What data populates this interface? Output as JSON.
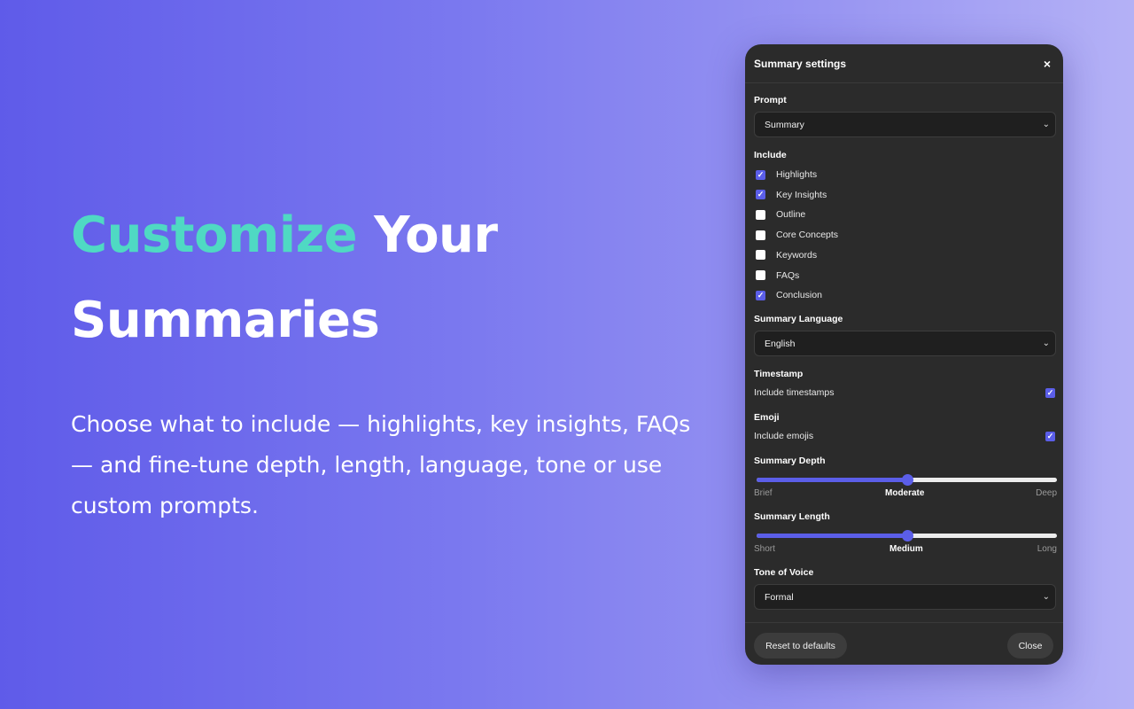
{
  "hero": {
    "title_accent": "Customize",
    "title_rest": "Your",
    "title_line2": "Summaries",
    "description": "Choose what to include — highlights, key insights, FAQs — and fine-tune depth, length, language, tone or use custom prompts."
  },
  "panel": {
    "title": "Summary settings",
    "close_icon": "×",
    "prompt": {
      "label": "Prompt",
      "value": "Summary"
    },
    "include": {
      "label": "Include",
      "items": [
        {
          "label": "Highlights",
          "checked": true
        },
        {
          "label": "Key Insights",
          "checked": true
        },
        {
          "label": "Outline",
          "checked": false
        },
        {
          "label": "Core Concepts",
          "checked": false
        },
        {
          "label": "Keywords",
          "checked": false
        },
        {
          "label": "FAQs",
          "checked": false
        },
        {
          "label": "Conclusion",
          "checked": true
        }
      ]
    },
    "language": {
      "label": "Summary Language",
      "value": "English"
    },
    "timestamp": {
      "label": "Timestamp",
      "option": "Include timestamps",
      "checked": true
    },
    "emoji": {
      "label": "Emoji",
      "option": "Include emojis",
      "checked": true
    },
    "depth": {
      "label": "Summary Depth",
      "min_label": "Brief",
      "mid_label": "Moderate",
      "max_label": "Deep",
      "value": 0.5
    },
    "length": {
      "label": "Summary Length",
      "min_label": "Short",
      "mid_label": "Medium",
      "max_label": "Long",
      "value": 0.5
    },
    "tone": {
      "label": "Tone of Voice",
      "value": "Formal"
    },
    "footer": {
      "reset_label": "Reset to defaults",
      "close_label": "Close"
    }
  },
  "colors": {
    "accent": "#5b5ee8",
    "title_accent": "#4fd9c3",
    "panel_bg": "#2b2b2b"
  },
  "icons": {
    "check": "check-icon",
    "chevron": "chevron-down-icon",
    "close": "close-icon"
  }
}
